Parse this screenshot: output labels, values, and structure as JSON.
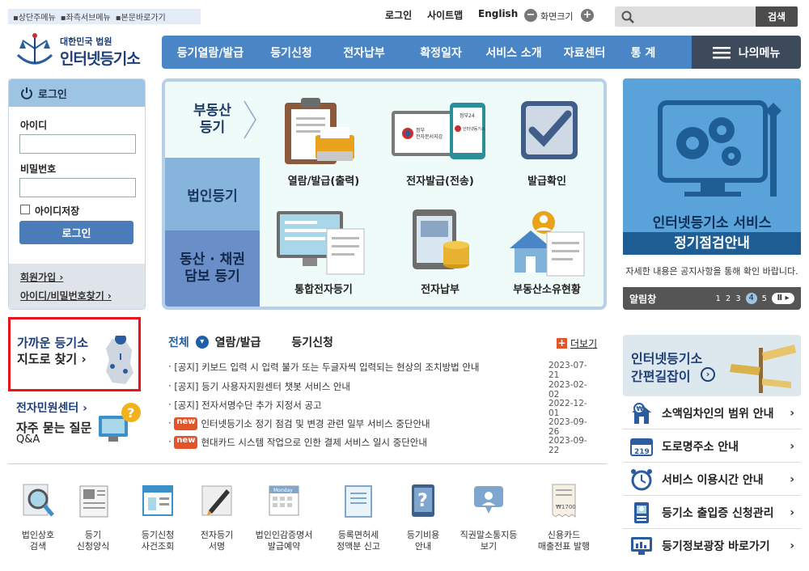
{
  "skip_links": [
    "▪상단주메뉴",
    "▪좌측서브메뉴",
    "▪본문바로가기"
  ],
  "util": {
    "login": "로그인",
    "sitemap": "사이트맵",
    "english": "English",
    "zoom": "화면크기",
    "minus": "−",
    "plus": "+"
  },
  "search": {
    "button": "검색",
    "placeholder": ""
  },
  "logo": {
    "line1": "대한민국 법원",
    "line2": "인터넷등기소"
  },
  "gnb": [
    "등기열람/발급",
    "등기신청",
    "전자납부",
    "확정일자",
    "서비스 소개",
    "자료센터",
    "통 계"
  ],
  "my_menu": "나의메뉴",
  "login": {
    "title": "로그인",
    "id_label": "아이디",
    "pw_label": "비밀번호",
    "save_id": "아이디저장",
    "button": "로그인",
    "join": "회원가입 ›",
    "find": "아이디/비밀번호찾기 ›"
  },
  "center": {
    "tabs": {
      "real_estate": "부동산\n등기",
      "corporate": "법인등기",
      "movable": "동산 · 채권\n담보 등기"
    },
    "services": [
      "열람/발급(출력)",
      "전자발급(전송)",
      "발급확인",
      "통합전자등기",
      "전자납부",
      "부동산소유현황"
    ],
    "icon_text": {
      "gov": "정부\n전자문서지갑",
      "gov24": "정부24",
      "court": "대한민국 법원\n인터넷등기소"
    }
  },
  "banner": {
    "title": "인터넷등기소 서비스",
    "subtitle": "정기점검안내",
    "desc": "자세한 내용은 공지사항을 통해 확인 바랍니다.",
    "alarm": "알림창",
    "pages": [
      "1",
      "2",
      "3",
      "4",
      "5"
    ],
    "active_page": "4"
  },
  "left_links": {
    "map1": "가까운 등기소",
    "map2": "지도로 찾기 ›",
    "civil": "전자민원센터 ›",
    "faq1": "자주 묻는 질문",
    "faq2": "Q&A"
  },
  "notice": {
    "tabs": [
      "전체",
      "열람/발급",
      "등기신청"
    ],
    "more": "더보기",
    "items": [
      {
        "text": "[공지] 키보드 입력 시 입력 불가 또는 두글자씩 입력되는 현상의 조치방법 안내",
        "date": "2023-07-21",
        "new": false
      },
      {
        "text": "[공지] 등기 사용자지원센터 챗봇 서비스 안내",
        "date": "2023-02-02",
        "new": false
      },
      {
        "text": "[공지] 전자서명수단 추가 지정서 공고",
        "date": "2022-12-01",
        "new": false
      },
      {
        "text": "인터넷등기소 정기 점검 및 변경 관련 일부 서비스 중단안내",
        "date": "2023-09-26",
        "new": true
      },
      {
        "text": "현대카드 시스템 작업으로 인한 결제 서비스 일시 중단안내",
        "date": "2023-09-22",
        "new": true
      }
    ],
    "new_label": "new"
  },
  "quick": [
    "법인상호\n검색",
    "등기\n신청양식",
    "등기신청\n사건조회",
    "전자등기\n서명",
    "법인인감증명서\n발급예약",
    "등록면허세\n정액분 신고",
    "등기비용\n안내",
    "직권말소통지등\n보기",
    "신용카드\n매출전표 발행"
  ],
  "quick_icon_text": {
    "monday": "Monday",
    "price": "₩1700"
  },
  "right": {
    "shortcut1": "인터넷등기소",
    "shortcut2": "간편길잡이",
    "list": [
      "소액임차인의 범위 안내",
      "도로명주소 안내",
      "서비스 이용시간 안내",
      "등기소 출입증 신청관리",
      "등기정보광장 바로가기"
    ],
    "road_num": "219"
  },
  "colors": {
    "primary": "#4a86c5",
    "dark": "#3d4a5c",
    "highlight_box": "#e8141c"
  }
}
